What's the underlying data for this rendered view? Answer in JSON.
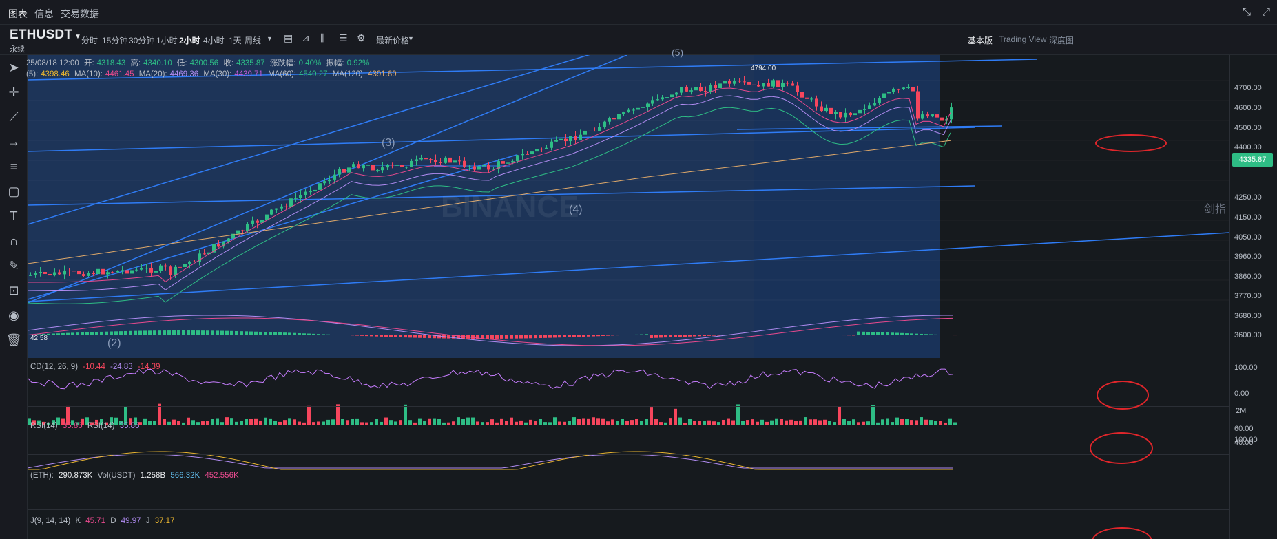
{
  "tabs": [
    {
      "label": "图表",
      "active": true
    },
    {
      "label": "信息",
      "active": false
    },
    {
      "label": "交易数据",
      "active": false
    }
  ],
  "window_icons": [
    "shrink-icon",
    "expand-icon"
  ],
  "symbol": {
    "name": "ETHUSDT",
    "sub": "永续"
  },
  "intervals": [
    {
      "label": "分时",
      "active": false
    },
    {
      "label": "15分钟",
      "active": false
    },
    {
      "label": "30分钟",
      "active": false
    },
    {
      "label": "1小时",
      "active": false
    },
    {
      "label": "2小时",
      "active": true
    },
    {
      "label": "4小时",
      "active": false
    },
    {
      "label": "1天",
      "active": false
    },
    {
      "label": "周线",
      "active": false
    }
  ],
  "price_type": "最新价格",
  "view_options": [
    {
      "label": "基本版",
      "active": true
    },
    {
      "label": "Trading View",
      "active": false
    },
    {
      "label": "深度图",
      "active": false
    }
  ],
  "ohlc": {
    "date": "25/08/18 12:00",
    "open_label": "开:",
    "open": "4318.43",
    "high_label": "高:",
    "high": "4340.10",
    "low_label": "低:",
    "low": "4300.56",
    "close_label": "收:",
    "close": "4335.87",
    "change_label": "涨跌幅:",
    "change": "0.40%",
    "amp_label": "振幅:",
    "amp": "0.92%"
  },
  "ma": [
    {
      "label": "(5):",
      "value": "4398.46",
      "color": "#e9b530"
    },
    {
      "label": "MA(10):",
      "value": "4461.45",
      "color": "#e84a8e"
    },
    {
      "label": "MA(20):",
      "value": "4469.36",
      "color": "#b18cf2"
    },
    {
      "label": "MA(30):",
      "value": "4439.71",
      "color": "#c35bd8"
    },
    {
      "label": "MA(60):",
      "value": "4540.27",
      "color": "#2ebd85"
    },
    {
      "label": "MA(120):",
      "value": "4391.69",
      "color": "#e0a96a"
    }
  ],
  "price_ticks": [
    "4700.00",
    "4600.00",
    "4500.00",
    "4400.00",
    "4250.00",
    "4150.00",
    "4050.00",
    "3960.00",
    "3860.00",
    "3770.00",
    "3680.00",
    "3600.00"
  ],
  "last_price": "4335.87",
  "high_marker": "4794.00",
  "low_marker": "42.58",
  "wave_labels": [
    "(2)",
    "(3)",
    "(4)",
    "(5)"
  ],
  "watermark": "BINANCE",
  "side_text": "剑指",
  "macd": {
    "label": "CD(12, 26, 9)",
    "dif": "-10.44",
    "dea": "-24.83",
    "hist": "-14.39",
    "ticks": [
      "100.00",
      "0.00"
    ]
  },
  "rsi": {
    "label": "RSI(14)",
    "value1": "35.86",
    "label2": "RSI(14)",
    "value2": "35.86",
    "ticks": [
      "60.00",
      "40.00"
    ]
  },
  "vol": {
    "label": "(ETH):",
    "value": "290.873K",
    "label2": "Vol(USDT)",
    "value2": "1.258B",
    "ma1": "566.32K",
    "ma2": "452.556K",
    "tick": "2M"
  },
  "kdj": {
    "label": "J(9, 14, 14)",
    "k_label": "K",
    "k": "45.71",
    "d_label": "D",
    "d": "49.97",
    "j_label": "J",
    "j": "37.17",
    "tick": "100.00"
  },
  "colors": {
    "up": "#2ebd85",
    "down": "#f6465d",
    "trendline": "#2f7cf6",
    "annotation": "#e0262b"
  }
}
